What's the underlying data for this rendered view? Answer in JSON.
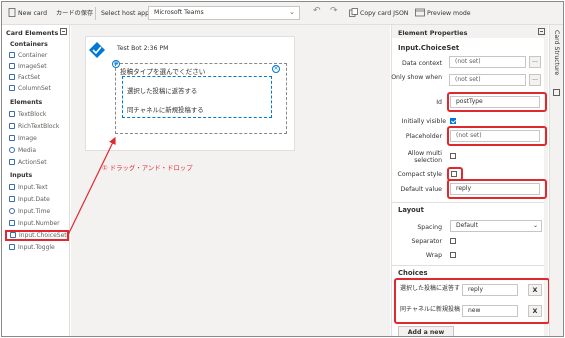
{
  "toolbar": {
    "new_card": "New card",
    "save_jp": "カードの保存",
    "host_label": "Select host app:",
    "host_value": "Microsoft Teams",
    "copy_json": "Copy card JSON",
    "preview": "Preview mode"
  },
  "left_panel": {
    "title": "Card Elements",
    "categories": {
      "containers": "Containers",
      "elements": "Elements",
      "inputs": "Inputs"
    },
    "containers": [
      "Container",
      "ImageSet",
      "FactSet",
      "ColumnSet"
    ],
    "elements": [
      "TextBlock",
      "RichTextBlock",
      "Image",
      "Media",
      "ActionSet"
    ],
    "inputs": [
      "Input.Text",
      "Input.Date",
      "Input.Time",
      "Input.Number",
      "Input.ChoiceSet",
      "Input.Toggle"
    ]
  },
  "canvas": {
    "card_title": "Test Bot 2:36 PM",
    "placeholder": "投稿タイプを選んでください",
    "options": [
      "選択した投稿に返答する",
      "同チャネルに新規投稿する"
    ],
    "annotation": "① ドラッグ・アンド・ドロップ"
  },
  "properties": {
    "title": "Element Properties",
    "section_main": "Input.ChoiceSet",
    "data_context_label": "Data context",
    "data_context_value": "(not set)",
    "only_show_label": "Only show when",
    "only_show_value": "(not set)",
    "id_label": "Id",
    "id_value": "postType",
    "initially_visible_label": "Initially visible",
    "placeholder_label": "Placeholder",
    "placeholder_value": "(not set)",
    "allow_multi_label": "Allow multi selection",
    "compact_label": "Compact style",
    "default_label": "Default value",
    "default_value": "reply",
    "layout_section": "Layout",
    "spacing_label": "Spacing",
    "spacing_value": "Default",
    "separator_label": "Separator",
    "wrap_label": "Wrap",
    "choices_section": "Choices",
    "choices": [
      {
        "title": "選択した投稿に返答す",
        "value": "reply"
      },
      {
        "title": "同チャネルに新規投稿",
        "value": "new"
      }
    ],
    "remove_label": "X",
    "add_choice": "Add a new choice",
    "ellipsis": "..."
  },
  "rail": {
    "label": "Card Structure"
  },
  "colors": {
    "accent": "#0078d4",
    "highlight": "#e0282e"
  }
}
